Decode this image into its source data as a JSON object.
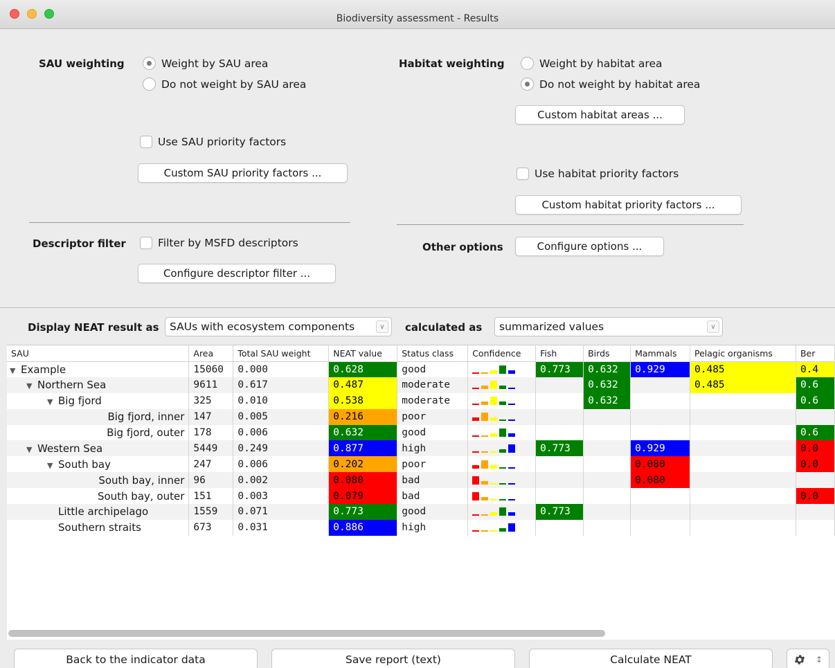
{
  "window": {
    "title": "Biodiversity assessment - Results"
  },
  "sau_weighting": {
    "label": "SAU weighting",
    "option_weight": "Weight by SAU area",
    "option_no_weight": "Do not weight by SAU area",
    "use_priority": "Use SAU priority factors",
    "custom_priority_button": "Custom SAU priority factors ..."
  },
  "habitat_weighting": {
    "label": "Habitat weighting",
    "option_weight": "Weight by habitat area",
    "option_no_weight": "Do not weight by habitat area",
    "custom_areas_button": "Custom habitat areas ...",
    "use_priority": "Use habitat priority factors",
    "custom_priority_button": "Custom habitat priority factors ..."
  },
  "descriptor_filter": {
    "label": "Descriptor filter",
    "filter_checkbox": "Filter by MSFD descriptors",
    "configure_button": "Configure descriptor filter ..."
  },
  "other_options": {
    "label": "Other options",
    "configure_button": "Configure options ..."
  },
  "display": {
    "label": "Display NEAT result as",
    "value": "SAUs with ecosystem components",
    "calc_label": "calculated as",
    "calc_value": "summarized values"
  },
  "table": {
    "columns": [
      "SAU",
      "Area",
      "Total SAU weight",
      "NEAT value",
      "Status class",
      "Confidence",
      "Fish",
      "Birds",
      "Mammals",
      "Pelagic organisms",
      "Ber"
    ],
    "rows": [
      {
        "sau": "Example",
        "level": 0,
        "tw": "▼",
        "area": "15060",
        "weight": "0.000",
        "neat": "0.628",
        "status": "good",
        "fish": "0.773",
        "birds": "0.632",
        "mammals": "0.929",
        "pelagic": "0.485",
        "ben": "0.4"
      },
      {
        "sau": "Northern Sea",
        "level": 1,
        "tw": "▼",
        "area": "9611",
        "weight": "0.617",
        "neat": "0.487",
        "status": "moderate",
        "fish": "",
        "birds": "0.632",
        "mammals": "",
        "pelagic": "0.485",
        "ben": "0.6"
      },
      {
        "sau": "Big fjord",
        "level": 2,
        "tw": "▼",
        "area": "325",
        "weight": "0.010",
        "neat": "0.538",
        "status": "moderate",
        "fish": "",
        "birds": "0.632",
        "mammals": "",
        "pelagic": "",
        "ben": "0.6"
      },
      {
        "sau": "Big fjord, inner",
        "level": 3,
        "tw": "",
        "area": "147",
        "weight": "0.005",
        "neat": "0.216",
        "status": "poor",
        "fish": "",
        "birds": "",
        "mammals": "",
        "pelagic": "",
        "ben": ""
      },
      {
        "sau": "Big fjord, outer",
        "level": 3,
        "tw": "",
        "area": "178",
        "weight": "0.006",
        "neat": "0.632",
        "status": "good",
        "fish": "",
        "birds": "",
        "mammals": "",
        "pelagic": "",
        "ben": "0.6"
      },
      {
        "sau": "Western Sea",
        "level": 1,
        "tw": "▼",
        "area": "5449",
        "weight": "0.249",
        "neat": "0.877",
        "status": "high",
        "fish": "0.773",
        "birds": "",
        "mammals": "0.929",
        "pelagic": "",
        "ben": "0.0"
      },
      {
        "sau": "South bay",
        "level": 2,
        "tw": "▼",
        "area": "247",
        "weight": "0.006",
        "neat": "0.202",
        "status": "poor",
        "fish": "",
        "birds": "",
        "mammals": "0.080",
        "pelagic": "",
        "ben": "0.0"
      },
      {
        "sau": "South bay, inner",
        "level": 3,
        "tw": "",
        "area": "96",
        "weight": "0.002",
        "neat": "0.080",
        "status": "bad",
        "fish": "",
        "birds": "",
        "mammals": "0.080",
        "pelagic": "",
        "ben": ""
      },
      {
        "sau": "South bay, outer",
        "level": 3,
        "tw": "",
        "area": "151",
        "weight": "0.003",
        "neat": "0.079",
        "status": "bad",
        "fish": "",
        "birds": "",
        "mammals": "",
        "pelagic": "",
        "ben": "0.0"
      },
      {
        "sau": "Little archipelago",
        "level": 2,
        "tw": "",
        "area": "1559",
        "weight": "0.071",
        "neat": "0.773",
        "status": "good",
        "fish": "0.773",
        "birds": "",
        "mammals": "",
        "pelagic": "",
        "ben": ""
      },
      {
        "sau": "Southern straits",
        "level": 2,
        "tw": "",
        "area": "673",
        "weight": "0.031",
        "neat": "0.886",
        "status": "high",
        "fish": "",
        "birds": "",
        "mammals": "",
        "pelagic": "",
        "ben": ""
      }
    ]
  },
  "status_colors": {
    "bad": "#ff0000",
    "poor": "#ffa500",
    "moderate": "#ffff00",
    "good": "#008000",
    "high": "#0000ff"
  },
  "footer": {
    "back_button": "Back to the indicator data",
    "save_button": "Save report (text)",
    "calc_button": "Calculate NEAT",
    "gear_icon": "gear-icon"
  }
}
